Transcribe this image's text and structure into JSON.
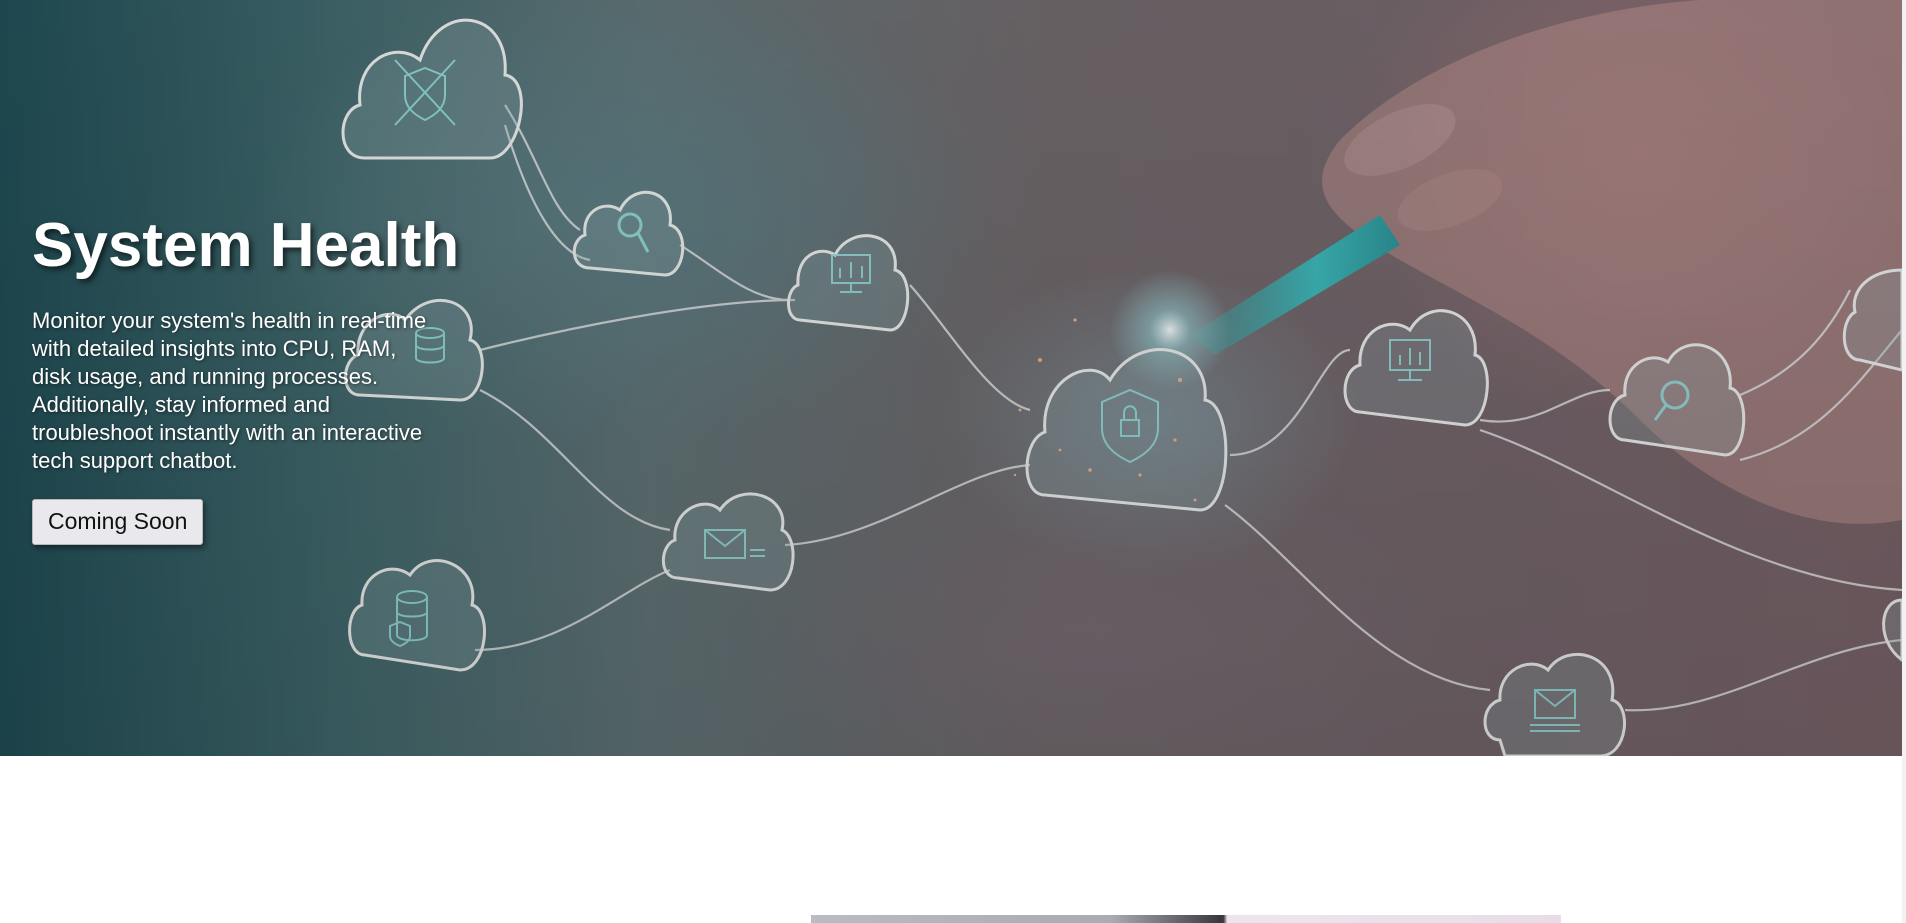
{
  "hero": {
    "title": "System Health",
    "description": "Monitor your system's health in real-time with detailed insights into CPU, RAM, disk usage, and running processes. Additionally, stay informed and troubleshoot instantly with an interactive tech support chatbot.",
    "button_label": "Coming Soon"
  },
  "colors": {
    "overlay_teal": "#1f4a52",
    "overlay_mauve": "#745f65",
    "icon_accent": "#8fd6d3",
    "button_bg": "#e9e9ed"
  },
  "icons": [
    "shield-icon",
    "search-icon",
    "chart-monitor-icon",
    "database-icon",
    "lock-icon",
    "mail-icon",
    "database-shield-icon"
  ]
}
